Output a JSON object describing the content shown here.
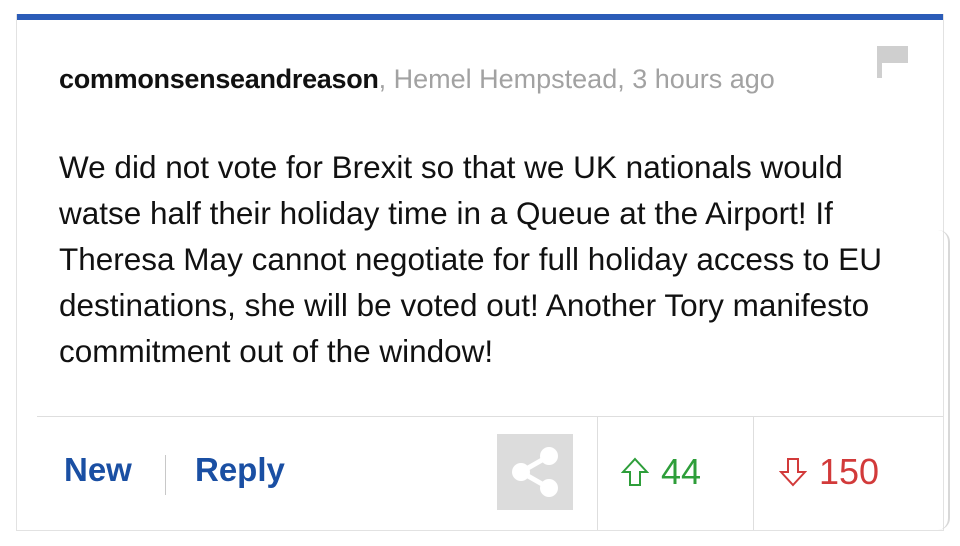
{
  "comment": {
    "author": "commonsenseandreason",
    "meta": ", Hemel Hempstead, 3 hours ago",
    "text": "We did not vote for Brexit so that we UK nationals would watse half their holiday time in a Queue at the Airport! If Theresa May cannot negotiate for full holiday access to EU destinations, she will be voted out! Another Tory manifesto commitment out of the window!"
  },
  "actions": {
    "new_label": "New",
    "reply_label": "Reply",
    "upvotes": "44",
    "downvotes": "150"
  },
  "icons": {
    "flag": "flag-icon",
    "share": "share-icon",
    "up": "arrow-up-icon",
    "down": "arrow-down-icon"
  },
  "colors": {
    "accent": "#2b5cb8",
    "link": "#1a4fa3",
    "upvote": "#2e9e3a",
    "downvote": "#d23a3a"
  }
}
